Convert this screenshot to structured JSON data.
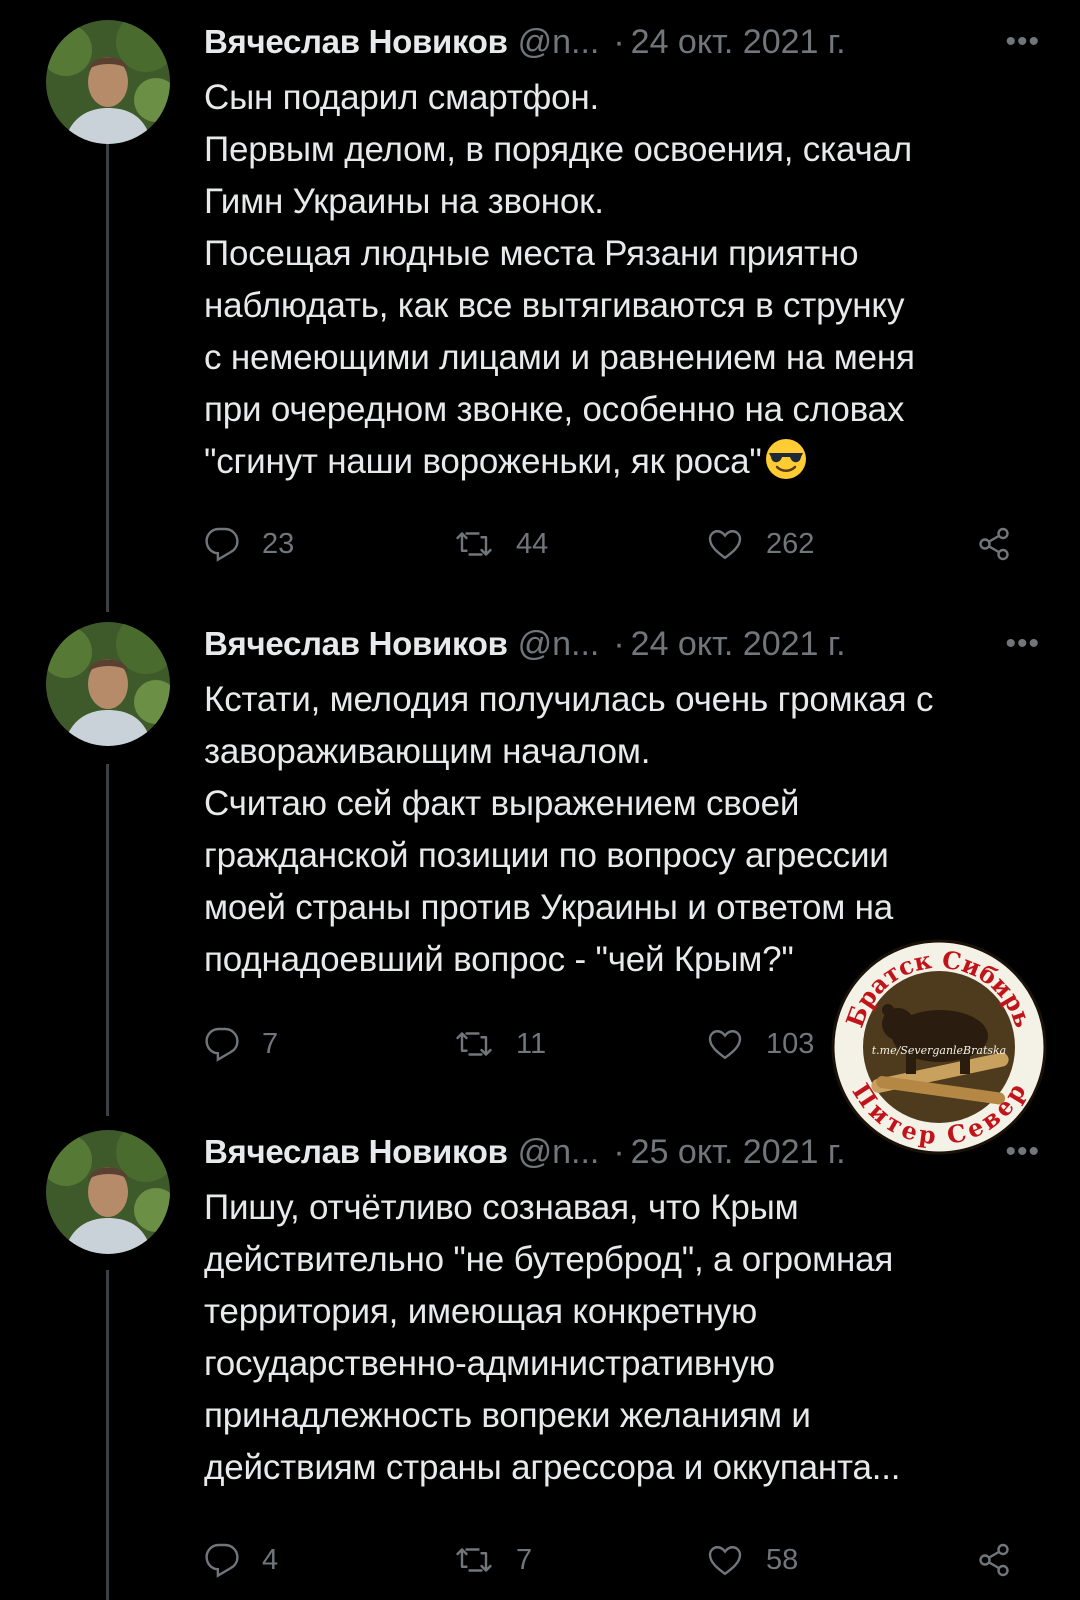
{
  "tweets": [
    {
      "author_name": "Вячеслав Новиков",
      "handle": "@n...",
      "separator": "·",
      "date": "24 окт. 2021 г.",
      "more_label": "•••",
      "text": "Сын подарил смартфон.\nПервым делом, в порядке освоения, скачал\nГимн Украины на звонок.\nПосещая людные места Рязани приятно\nнаблюдать, как все вытягиваются в струнку\nс немеющими лицами и равнением на меня\nпри очередном звонке, особенно на словах\n\"сгинут наши вороженьки, як роса\"",
      "emoji": "smiling-face-with-sunglasses",
      "replies": "23",
      "retweets": "44",
      "likes": "262"
    },
    {
      "author_name": "Вячеслав Новиков",
      "handle": "@n...",
      "separator": "·",
      "date": "24 окт. 2021 г.",
      "more_label": "•••",
      "text": "Кстати, мелодия получилась очень громкая с\nзавораживающим началом.\nСчитаю сей факт выражением своей\nгражданской позиции по вопросу агрессии\nмоей страны против Украины и ответом на\nподнадоевший вопрос - \"чей Крым?\"",
      "replies": "7",
      "retweets": "11",
      "likes": "103"
    },
    {
      "author_name": "Вячеслав Новиков",
      "handle": "@n...",
      "separator": "·",
      "date": "25 окт. 2021 г.",
      "more_label": "•••",
      "text": "Пишу, отчётливо сознавая, что Крым\nдействительно \"не бутерброд\", а огромная\nтерритория, имеющая конкретную\nгосударственно-административную\nпринадлежность вопреки желаниям и\nдействиям страны агрессора и оккупанта...",
      "replies": "4",
      "retweets": "7",
      "likes": "58"
    }
  ],
  "watermark": {
    "text_top": "Братск Сибирь",
    "text_middle": "t.me/SeverganleBratska",
    "text_bottom": "Питер Север"
  },
  "icons": {
    "reply": "reply-icon",
    "retweet": "retweet-icon",
    "like": "heart-icon",
    "share": "share-icon"
  },
  "colors": {
    "background": "#000000",
    "text": "#e7e9ea",
    "muted": "#71767b",
    "thread_line": "#3e4144"
  }
}
